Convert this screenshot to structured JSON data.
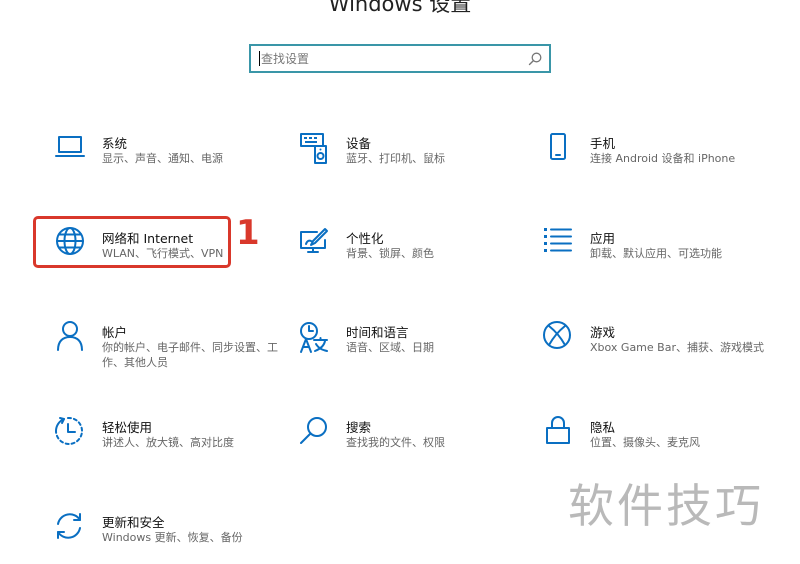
{
  "window_title": "Windows 设置",
  "search": {
    "placeholder": "查找设置"
  },
  "categories": [
    {
      "title": "系统",
      "desc": "显示、声音、通知、电源",
      "icon": "laptop-icon"
    },
    {
      "title": "设备",
      "desc": "蓝牙、打印机、鼠标",
      "icon": "devices-icon"
    },
    {
      "title": "手机",
      "desc": "连接 Android 设备和 iPhone",
      "icon": "phone-icon"
    },
    {
      "title": "网络和 Internet",
      "desc": "WLAN、飞行模式、VPN",
      "icon": "globe-icon"
    },
    {
      "title": "个性化",
      "desc": "背景、锁屏、颜色",
      "icon": "personalization-icon"
    },
    {
      "title": "应用",
      "desc": "卸载、默认应用、可选功能",
      "icon": "apps-list-icon"
    },
    {
      "title": "帐户",
      "desc": "你的帐户、电子邮件、同步设置、工作、其他人员",
      "icon": "person-icon"
    },
    {
      "title": "时间和语言",
      "desc": "语音、区域、日期",
      "icon": "time-language-icon"
    },
    {
      "title": "游戏",
      "desc": "Xbox Game Bar、捕获、游戏模式",
      "icon": "xbox-icon"
    },
    {
      "title": "轻松使用",
      "desc": "讲述人、放大镜、高对比度",
      "icon": "ease-of-access-icon"
    },
    {
      "title": "搜索",
      "desc": "查找我的文件、权限",
      "icon": "search-magnifier-icon"
    },
    {
      "title": "隐私",
      "desc": "位置、摄像头、麦克风",
      "icon": "lock-icon"
    },
    {
      "title": "更新和安全",
      "desc": "Windows 更新、恢复、备份",
      "icon": "sync-icon"
    }
  ],
  "annotation": {
    "step_number": "1",
    "color": "#d9382b"
  },
  "watermark": "软件技巧",
  "accent_color": "#0a6fc2"
}
